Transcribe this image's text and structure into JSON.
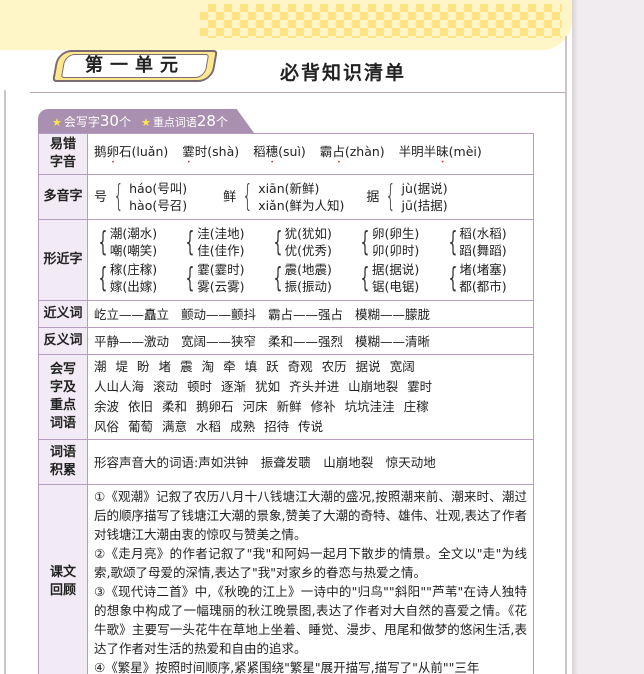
{
  "header": {
    "unit_title": "第一单元",
    "main_title": "必背知识清单",
    "stats": {
      "write_label": "会写字",
      "write_count": "30",
      "write_unit": "个",
      "vocab_label": "重点词语",
      "vocab_count": "28",
      "vocab_unit": "个"
    }
  },
  "colors": {
    "accent_purple": "#a98fb0",
    "cell_border": "#b59cc0",
    "highlight_yellow": "#ffe88d",
    "dot_red": "#d62e2e"
  },
  "rows": {
    "errors": {
      "category": "易错字音",
      "items": [
        {
          "pre": "鹅",
          "dot": "卵",
          "post": "石(luǎn)"
        },
        {
          "pre": "",
          "dot": "霎",
          "post": "时(shà)"
        },
        {
          "pre": "稻",
          "dot": "穗",
          "post": "(suì)"
        },
        {
          "pre": "霸",
          "dot": "占",
          "post": "(zhàn)"
        },
        {
          "pre": "半明半",
          "dot": "昧",
          "post": "(mèi)"
        }
      ]
    },
    "polyphones": {
      "category": "多音字",
      "groups": [
        {
          "char": "号",
          "a": "háo(号叫)",
          "b": "hào(号召)"
        },
        {
          "char": "鲜",
          "a": "xiān(新鲜)",
          "b": "xiǎn(鲜为人知)"
        },
        {
          "char": "据",
          "a": "jù(据说)",
          "b": "jū(拮据)"
        }
      ]
    },
    "similar_shapes": {
      "category": "形近字",
      "groups": [
        {
          "a": "潮(潮水)",
          "b": "嘲(嘲笑)"
        },
        {
          "a": "洼(洼地)",
          "b": "佳(佳作)"
        },
        {
          "a": "犹(犹如)",
          "b": "优(优秀)"
        },
        {
          "a": "卵(卵生)",
          "b": "卯(卯时)"
        },
        {
          "a": "稻(水稻)",
          "b": "蹈(舞蹈)"
        },
        {
          "a": "稼(庄稼)",
          "b": "嫁(出嫁)"
        },
        {
          "a": "霎(霎时)",
          "b": "雾(云雾)"
        },
        {
          "a": "震(地震)",
          "b": "振(振动)"
        },
        {
          "a": "据(据说)",
          "b": "锯(电锯)"
        },
        {
          "a": "堵(堵塞)",
          "b": "都(都市)"
        }
      ]
    },
    "synonyms": {
      "category": "近义词",
      "pairs": [
        "屹立——矗立",
        "颤动——颤抖",
        "霸占——强占",
        "模糊——朦胧"
      ]
    },
    "antonyms": {
      "category": "反义词",
      "pairs": [
        "平静——激动",
        "宽阔——狭窄",
        "柔和——强烈",
        "模糊——清晰"
      ]
    },
    "key_words": {
      "category": "会写字及重点词语",
      "line1": [
        "潮",
        "堤",
        "盼",
        "堵",
        "震",
        "淘",
        "牵",
        "填",
        "跃",
        "奇观",
        "农历",
        "据说",
        "宽阔"
      ],
      "line2": [
        "人山人海",
        "滚动",
        "顿时",
        "逐渐",
        "犹如",
        "齐头并进",
        "山崩地裂",
        "霎时"
      ],
      "line3": [
        "余波",
        "依旧",
        "柔和",
        "鹅卵石",
        "河床",
        "新鲜",
        "修补",
        "坑坑洼洼",
        "庄稼"
      ],
      "line4": [
        "风俗",
        "葡萄",
        "满意",
        "水稻",
        "成熟",
        "招待",
        "传说"
      ]
    },
    "accumulation": {
      "category": "词语积累",
      "text": "形容声音大的词语:声如洪钟　振聋发聩　山崩地裂　惊天动地"
    },
    "review": {
      "category": "课文回顾",
      "paragraphs": [
        "①《观潮》记叙了农历八月十八钱塘江大潮的盛况,按照潮来前、潮来时、潮过后的顺序描写了钱塘江大潮的景象,赞美了大潮的奇特、雄伟、壮观,表达了作者对钱塘江大潮由衷的惊叹与赞美之情。",
        "②《走月亮》的作者记叙了\"我\"和阿妈一起月下散步的情景。全文以\"走\"为线索,歌颂了母爱的深情,表达了\"我\"对家乡的眷恋与热爱之情。",
        "③《现代诗二首》中,《秋晚的江上》一诗中的\"归鸟\"\"斜阳\"\"芦苇\"在诗人独特的想象中构成了一幅瑰丽的秋江晚景图,表达了作者对大自然的喜爱之情。《花牛歌》主要写一头花牛在草地上坐着、睡觉、漫步、甩尾和做梦的悠闲生活,表达了作者对生活的热爱和自由的追求。",
        "④《繁星》按照时间顺序,紧紧围绕\"繁星\"展开描写,描写了\"从前\"\"三年"
      ]
    }
  }
}
